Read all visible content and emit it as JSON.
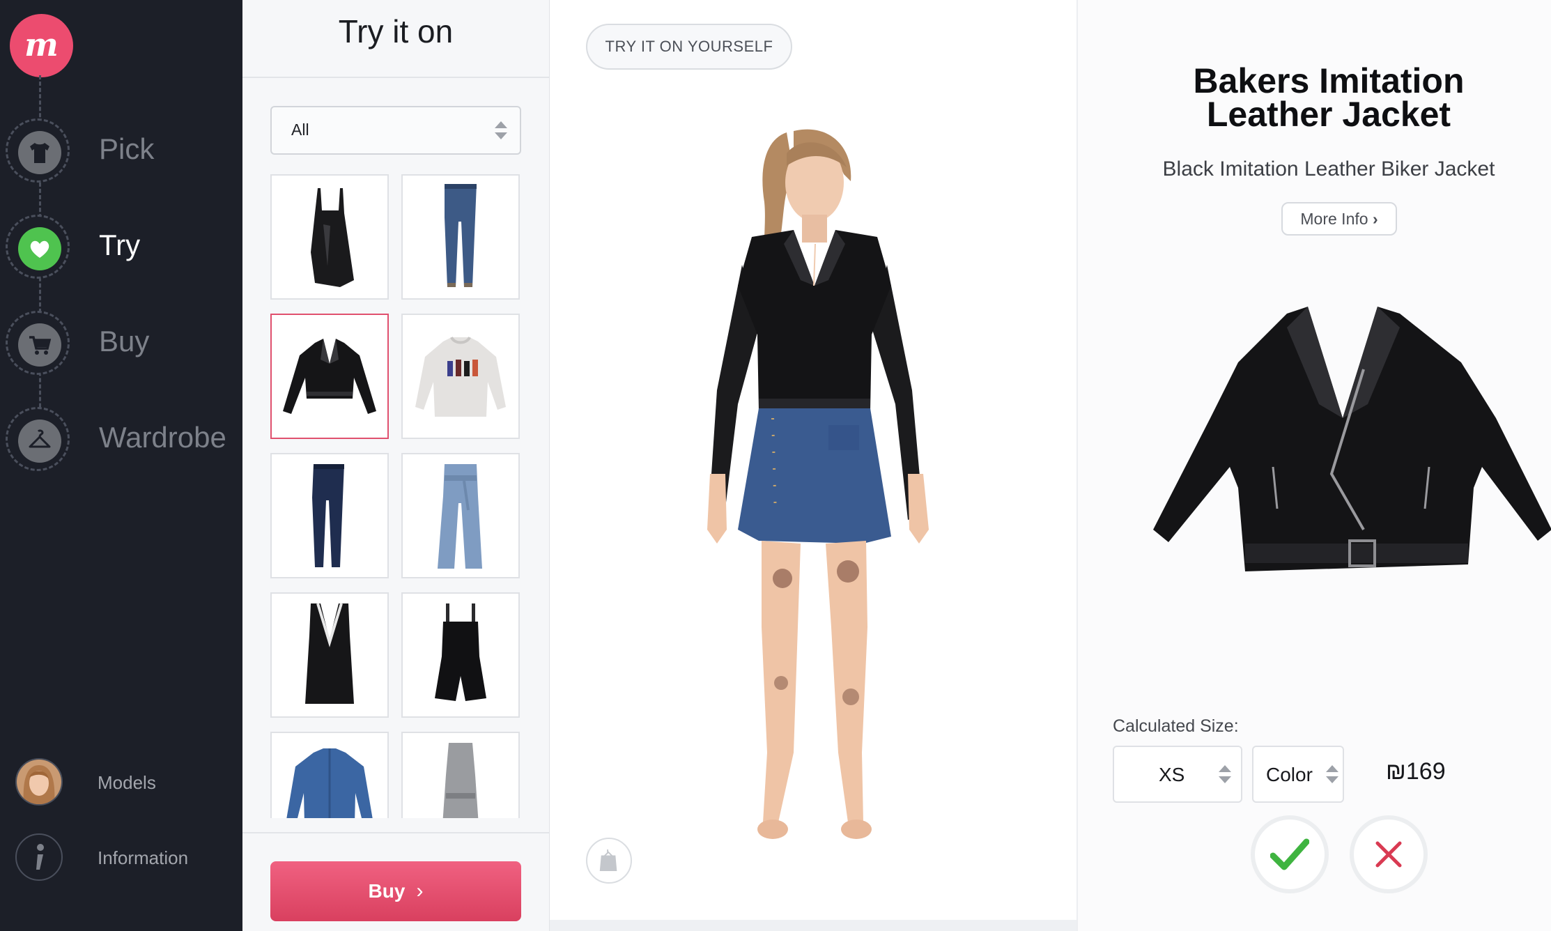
{
  "app": {
    "logo_letter": "m",
    "accent": "#ec4c6f",
    "active_step_color": "#4fc34f"
  },
  "sidebar": {
    "steps": [
      {
        "label": "Pick",
        "icon": "tshirt-icon",
        "active": false
      },
      {
        "label": "Try",
        "icon": "heart-icon",
        "active": true
      },
      {
        "label": "Buy",
        "icon": "cart-icon",
        "active": false
      },
      {
        "label": "Wardrobe",
        "icon": "hanger-icon",
        "active": false
      }
    ],
    "links": [
      {
        "label": "Models",
        "icon": "model-avatar-icon"
      },
      {
        "label": "Information",
        "icon": "info-icon"
      }
    ]
  },
  "catalog": {
    "title": "Try it on",
    "filter_value": "All",
    "items": [
      {
        "name": "black-slip-top",
        "selected": false
      },
      {
        "name": "skinny-jeans",
        "selected": false
      },
      {
        "name": "black-leather-jacket",
        "selected": true
      },
      {
        "name": "graphic-sweatshirt",
        "selected": false
      },
      {
        "name": "dark-jeans",
        "selected": false
      },
      {
        "name": "wide-leg-jeans",
        "selected": false
      },
      {
        "name": "black-vneck-dress",
        "selected": false
      },
      {
        "name": "black-romper",
        "selected": false
      },
      {
        "name": "denim-shirt",
        "selected": false
      },
      {
        "name": "grey-dress",
        "selected": false
      }
    ],
    "buy_label": "Buy"
  },
  "stage": {
    "try_yourself_label": "TRY IT ON YOURSELF"
  },
  "product": {
    "name": "Bakers Imitation Leather Jacket",
    "description": "Black Imitation Leather Biker Jacket",
    "more_info_label": "More Info",
    "size_caption": "Calculated Size:",
    "size_value": "XS",
    "color_value": "Color",
    "price": "₪169"
  }
}
